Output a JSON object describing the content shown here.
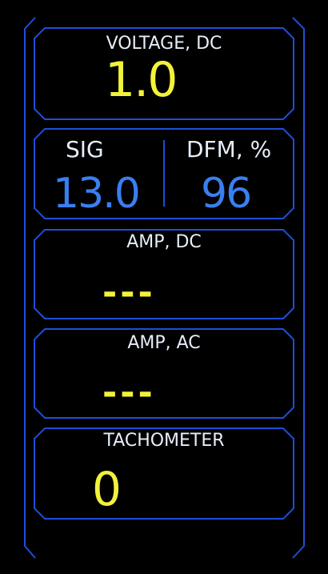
{
  "colors": {
    "frame": "#1d4fd8",
    "label": "#e6eef8",
    "primary_value": "#f2f23a",
    "secondary_value": "#3a7ff0"
  },
  "voltage_dc": {
    "label": "VOLTAGE, DC",
    "value": "1.0"
  },
  "signal": {
    "sig_label": "SIG",
    "sig_value": "13.0",
    "dfm_label": "DFM, %",
    "dfm_value": "96"
  },
  "amp_dc": {
    "label": "AMP, DC",
    "value": "---"
  },
  "amp_ac": {
    "label": "AMP, AC",
    "value": "---"
  },
  "tachometer": {
    "label": "TACHOMETER",
    "value": "0"
  }
}
